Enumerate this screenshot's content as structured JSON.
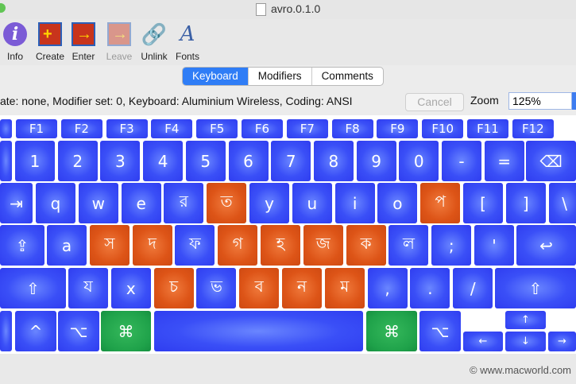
{
  "window": {
    "title": "avro.0.1.0"
  },
  "toolbar": {
    "info": "Info",
    "create": "Create",
    "enter": "Enter",
    "leave": "Leave",
    "unlink": "Unlink",
    "fonts": "Fonts"
  },
  "tabs": [
    "Keyboard",
    "Modifiers",
    "Comments"
  ],
  "status": {
    "text": "ate: none, Modifier set: 0, Keyboard: Aluminium Wireless, Coding: ANSI",
    "cancel": "Cancel",
    "zoom_label": "Zoom",
    "zoom_value": "125%"
  },
  "keys": {
    "fn": [
      "F1",
      "F2",
      "F3",
      "F4",
      "F5",
      "F6",
      "F7",
      "F8",
      "F9",
      "F10",
      "F11",
      "F12"
    ],
    "num": [
      "1",
      "2",
      "3",
      "4",
      "5",
      "6",
      "7",
      "8",
      "9",
      "0",
      "-",
      "=",
      "⌫"
    ],
    "row_q": [
      "⇥",
      "q",
      "w",
      "e",
      "র",
      "ত",
      "y",
      "u",
      "i",
      "o",
      "প",
      "[",
      "]",
      "\\"
    ],
    "row_a": [
      "⇪",
      "a",
      "স",
      "দ",
      "ফ",
      "গ",
      "হ",
      "জ",
      "ক",
      "ল",
      ";",
      "'",
      "↩"
    ],
    "row_z": [
      "⇧",
      "য",
      "x",
      "চ",
      "ভ",
      "ব",
      "ন",
      "ম",
      ",",
      ".",
      "/",
      "⇧"
    ],
    "row_b": [
      "⌃",
      "^",
      "⌥",
      "⌘",
      "",
      "⌘",
      "⌥",
      "↑",
      "←",
      "↓",
      "→"
    ]
  },
  "watermark": "© www.macworld.com",
  "colors": {
    "key_blue": "#3a4ff7",
    "key_orange": "#dd5417",
    "key_green": "#1fa24a",
    "tab_active": "#2f7df6"
  }
}
